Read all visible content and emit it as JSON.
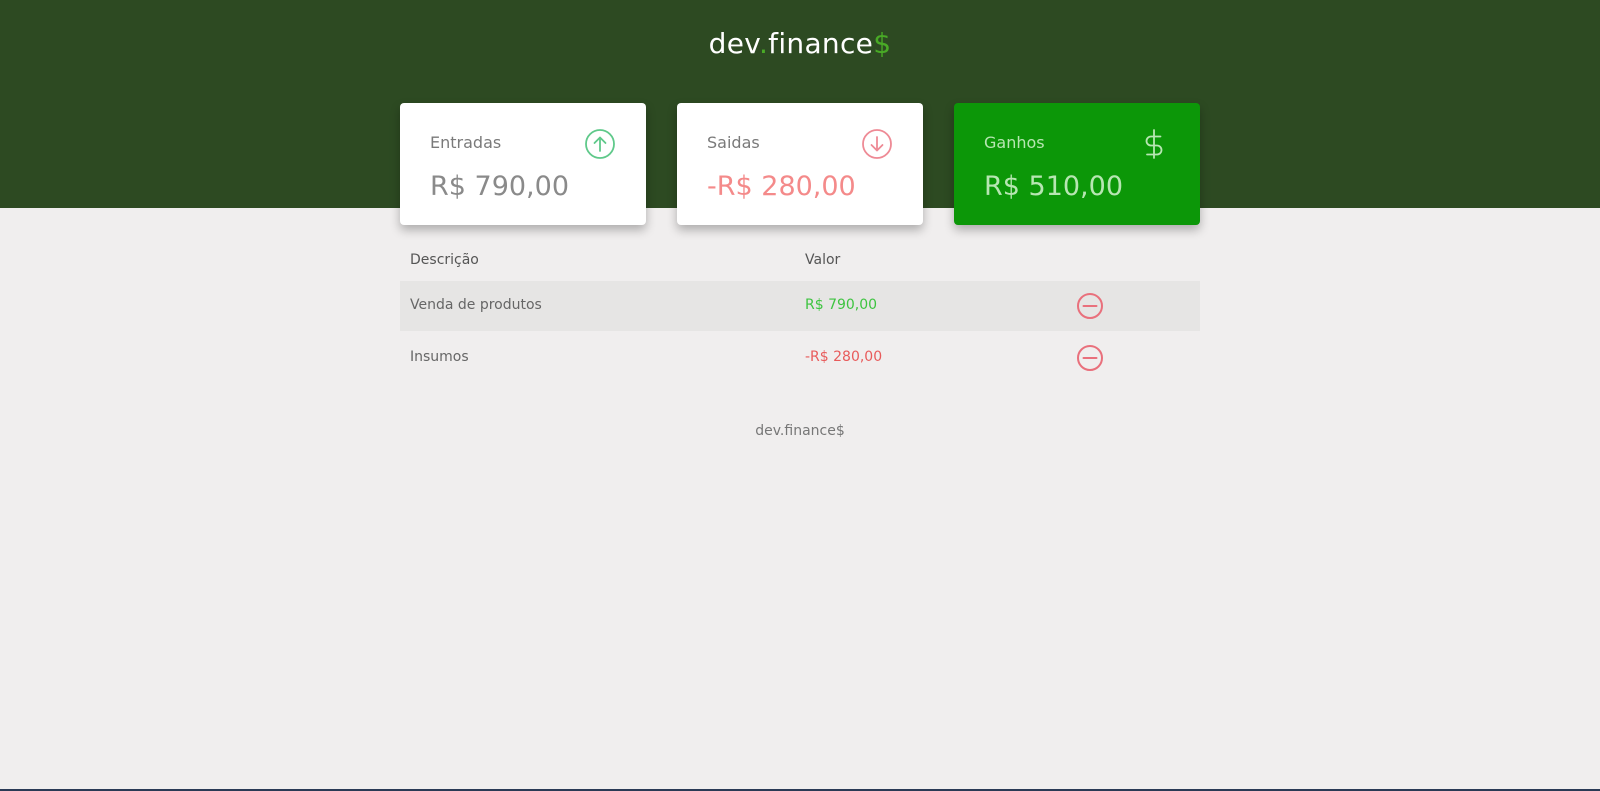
{
  "header": {
    "logo_part1": "dev",
    "logo_dot": ".",
    "logo_part2": "finance",
    "logo_dollar": "$"
  },
  "cards": {
    "incomes": {
      "title": "Entradas",
      "value": "R$ 790,00",
      "icon": "arrow-up-circle-icon"
    },
    "expenses": {
      "title": "Saidas",
      "value": "-R$ 280,00",
      "icon": "arrow-down-circle-icon"
    },
    "total": {
      "title": "Ganhos",
      "value": "R$ 510,00",
      "icon": "dollar-sign-icon"
    }
  },
  "table": {
    "headers": {
      "description": "Descrição",
      "amount": "Valor"
    },
    "rows": [
      {
        "description": "Venda de produtos",
        "amount": "R$ 790,00",
        "type": "income"
      },
      {
        "description": "Insumos",
        "amount": "-R$ 280,00",
        "type": "expense"
      }
    ]
  },
  "footer": {
    "text": "dev.finance$"
  },
  "colors": {
    "header_bg": "#2d4a22",
    "accent": "#49aa26",
    "total_card": "#0c9708",
    "income": "#3ec440",
    "expense": "#e85b5b",
    "page_bg": "#f0eeee"
  }
}
